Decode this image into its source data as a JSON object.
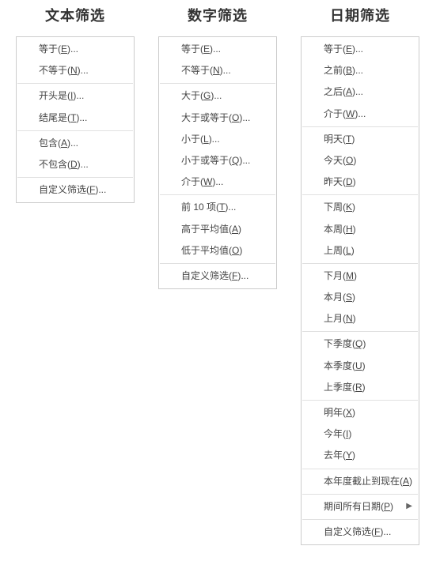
{
  "columns": [
    {
      "heading": "文本筛选",
      "name": "text-filter",
      "groups": [
        [
          {
            "prefix": "等于(",
            "key": "E",
            "suffix": ")..."
          },
          {
            "prefix": "不等于(",
            "key": "N",
            "suffix": ")..."
          }
        ],
        [
          {
            "prefix": "开头是(",
            "key": "I",
            "suffix": ")..."
          },
          {
            "prefix": "结尾是(",
            "key": "T",
            "suffix": ")..."
          }
        ],
        [
          {
            "prefix": "包含(",
            "key": "A",
            "suffix": ")..."
          },
          {
            "prefix": "不包含(",
            "key": "D",
            "suffix": ")..."
          }
        ],
        [
          {
            "prefix": "自定义筛选(",
            "key": "F",
            "suffix": ")..."
          }
        ]
      ]
    },
    {
      "heading": "数字筛选",
      "name": "number-filter",
      "groups": [
        [
          {
            "prefix": "等于(",
            "key": "E",
            "suffix": ")..."
          },
          {
            "prefix": "不等于(",
            "key": "N",
            "suffix": ")..."
          }
        ],
        [
          {
            "prefix": "大于(",
            "key": "G",
            "suffix": ")..."
          },
          {
            "prefix": "大于或等于(",
            "key": "O",
            "suffix": ")..."
          },
          {
            "prefix": "小于(",
            "key": "L",
            "suffix": ")..."
          },
          {
            "prefix": "小于或等于(",
            "key": "Q",
            "suffix": ")..."
          },
          {
            "prefix": "介于(",
            "key": "W",
            "suffix": ")..."
          }
        ],
        [
          {
            "prefix": "前 10 项(",
            "key": "T",
            "suffix": ")..."
          },
          {
            "prefix": "高于平均值(",
            "key": "A",
            "suffix": ")"
          },
          {
            "prefix": "低于平均值(",
            "key": "O",
            "suffix": ")"
          }
        ],
        [
          {
            "prefix": "自定义筛选(",
            "key": "F",
            "suffix": ")..."
          }
        ]
      ]
    },
    {
      "heading": "日期筛选",
      "name": "date-filter",
      "groups": [
        [
          {
            "prefix": "等于(",
            "key": "E",
            "suffix": ")..."
          },
          {
            "prefix": "之前(",
            "key": "B",
            "suffix": ")..."
          },
          {
            "prefix": "之后(",
            "key": "A",
            "suffix": ")..."
          },
          {
            "prefix": "介于(",
            "key": "W",
            "suffix": ")..."
          }
        ],
        [
          {
            "prefix": "明天(",
            "key": "T",
            "suffix": ")"
          },
          {
            "prefix": "今天(",
            "key": "O",
            "suffix": ")"
          },
          {
            "prefix": "昨天(",
            "key": "D",
            "suffix": ")"
          }
        ],
        [
          {
            "prefix": "下周(",
            "key": "K",
            "suffix": ")"
          },
          {
            "prefix": "本周(",
            "key": "H",
            "suffix": ")"
          },
          {
            "prefix": "上周(",
            "key": "L",
            "suffix": ")"
          }
        ],
        [
          {
            "prefix": "下月(",
            "key": "M",
            "suffix": ")"
          },
          {
            "prefix": "本月(",
            "key": "S",
            "suffix": ")"
          },
          {
            "prefix": "上月(",
            "key": "N",
            "suffix": ")"
          }
        ],
        [
          {
            "prefix": "下季度(",
            "key": "Q",
            "suffix": ")"
          },
          {
            "prefix": "本季度(",
            "key": "U",
            "suffix": ")"
          },
          {
            "prefix": "上季度(",
            "key": "R",
            "suffix": ")"
          }
        ],
        [
          {
            "prefix": "明年(",
            "key": "X",
            "suffix": ")"
          },
          {
            "prefix": "今年(",
            "key": "I",
            "suffix": ")"
          },
          {
            "prefix": "去年(",
            "key": "Y",
            "suffix": ")"
          }
        ],
        [
          {
            "prefix": "本年度截止到现在(",
            "key": "A",
            "suffix": ")"
          }
        ],
        [
          {
            "prefix": "期间所有日期(",
            "key": "P",
            "suffix": ")",
            "submenu": true
          }
        ],
        [
          {
            "prefix": "自定义筛选(",
            "key": "F",
            "suffix": ")..."
          }
        ]
      ]
    }
  ],
  "arrow_glyph": "▶"
}
